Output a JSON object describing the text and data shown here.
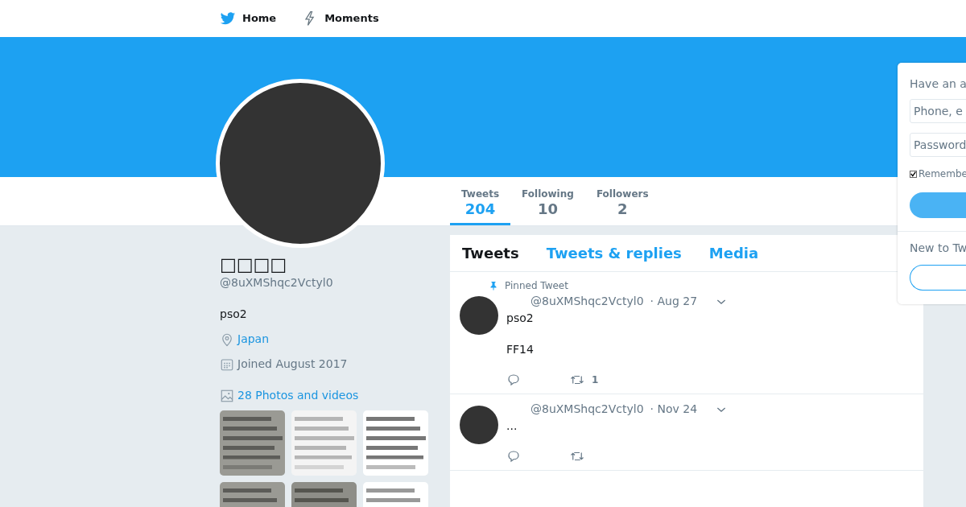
{
  "nav": {
    "items": [
      {
        "kind": "home",
        "label": "Home"
      },
      {
        "kind": "moments",
        "label": "Moments"
      }
    ]
  },
  "stats": [
    {
      "label": "Tweets",
      "value": "204",
      "selected": true
    },
    {
      "label": "Following",
      "value": "10",
      "selected": false
    },
    {
      "label": "Followers",
      "value": "2",
      "selected": false
    }
  ],
  "profile": {
    "name": "□□□□",
    "handle": "@8uXMShqc2Vctyl0",
    "bio": "pso2",
    "location": "Japan",
    "joined": "Joined August 2017",
    "media_link": "28 Photos and videos"
  },
  "timeline_tabs": [
    {
      "label": "Tweets",
      "selected": true
    },
    {
      "label": "Tweets & replies",
      "selected": false
    },
    {
      "label": "Media",
      "selected": false
    }
  ],
  "tweets": [
    {
      "pinned_label": "Pinned Tweet",
      "handle": "@8uXMShqc2Vctyl0",
      "date": "· Aug 27",
      "paragraphs": [
        "pso2",
        "FF14"
      ],
      "retweets": "1"
    },
    {
      "handle": "@8uXMShqc2Vctyl0",
      "date": "· Nov 24",
      "paragraphs": [
        "..."
      ]
    }
  ],
  "login": {
    "title": "Have an a",
    "username_placeholder": "Phone, e",
    "password_placeholder": "Password",
    "remember_label": "Remembe",
    "remember_checked": true,
    "signup_title": "New to Tw"
  }
}
